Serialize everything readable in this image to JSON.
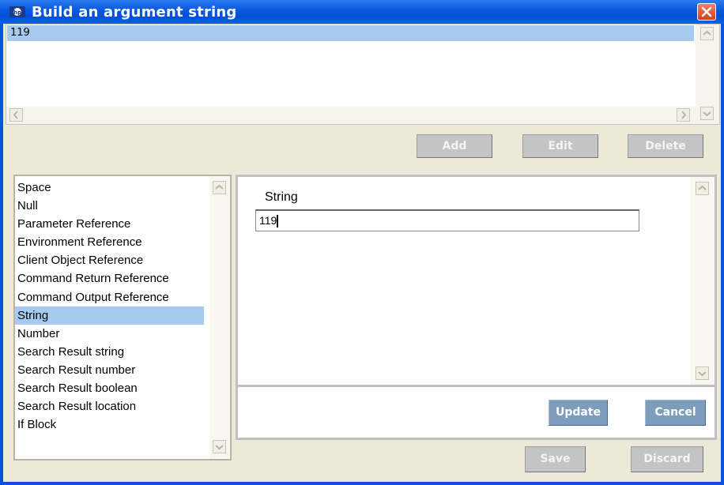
{
  "window": {
    "title": "Build an argument string",
    "app_icon": "hp-logo-icon",
    "close_icon": "close-icon"
  },
  "argument_list": {
    "rows": [
      "119"
    ],
    "selected_index": 0
  },
  "list_buttons": {
    "add": "Add",
    "edit": "Edit",
    "delete": "Delete"
  },
  "types": {
    "items": [
      "Space",
      "Null",
      "Parameter Reference",
      "Environment Reference",
      "Client Object Reference",
      "Command Return Reference",
      "Command Output Reference",
      "String",
      "Number",
      "Search Result string",
      "Search Result number",
      "Search Result boolean",
      "Search Result location",
      "If Block"
    ],
    "selected": "String"
  },
  "editor": {
    "label": "String",
    "value": "119"
  },
  "editor_buttons": {
    "update": "Update",
    "cancel": "Cancel"
  },
  "dialog_buttons": {
    "save": "Save",
    "discard": "Discard"
  },
  "colors": {
    "titlebar": "#0a5ae0",
    "selection": "#a6caf0",
    "active_button": "#7e9dbc",
    "disabled_button": "#c4c4c4",
    "dialog_bg": "#ece9d8"
  }
}
